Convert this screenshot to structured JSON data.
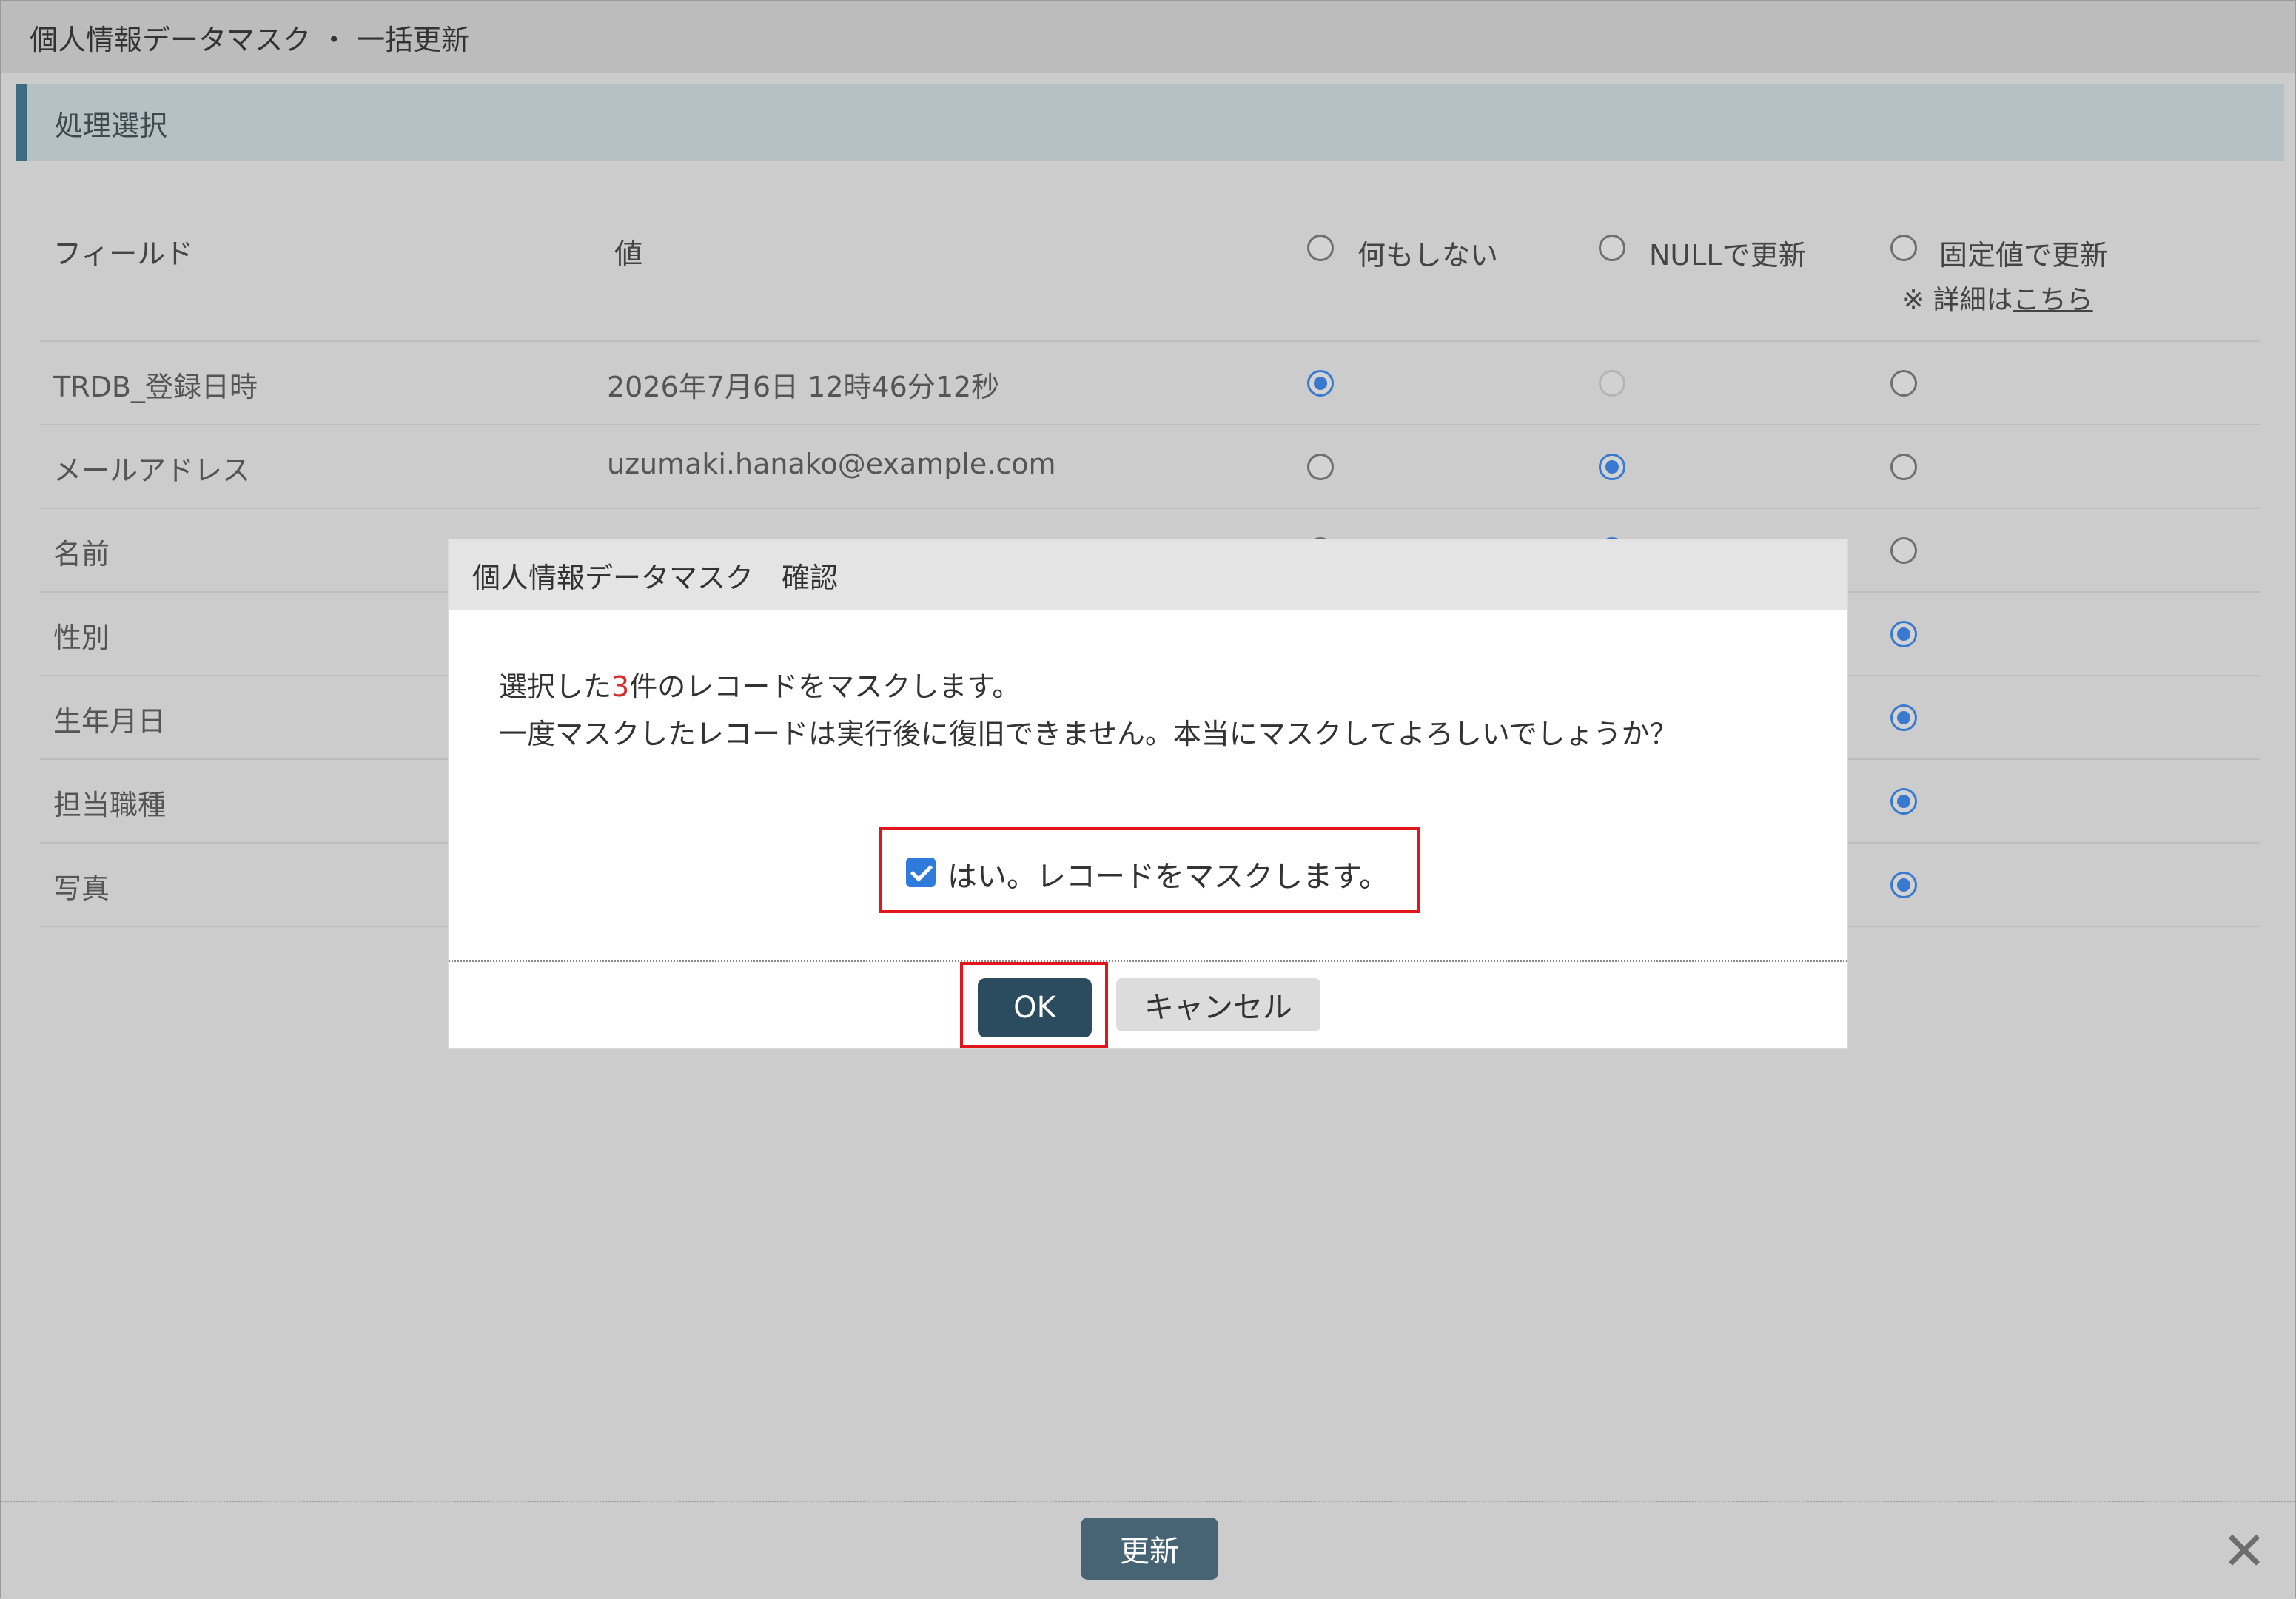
{
  "window": {
    "title": "個人情報データマスク ・ 一括更新"
  },
  "section": {
    "title": "処理選択"
  },
  "table": {
    "headers": {
      "field": "フィールド",
      "value": "値",
      "option_none": "何もしない",
      "option_null": "NULLで更新",
      "option_fixed": "固定値で更新",
      "note_prefix": "※ 詳細は",
      "note_link": "こちら"
    },
    "rows": [
      {
        "field": "TRDB_登録日時",
        "value": "2026年7月6日 12時46分12秒",
        "selected": "none",
        "null_disabled": true
      },
      {
        "field": "メールアドレス",
        "value": "uzumaki.hanako@example.com",
        "selected": "null",
        "null_disabled": false
      },
      {
        "field": "名前",
        "value": "",
        "selected": "null",
        "null_disabled": false
      },
      {
        "field": "性別",
        "value": "",
        "selected": "fixed",
        "null_disabled": false
      },
      {
        "field": "生年月日",
        "value": "",
        "selected": "fixed",
        "null_disabled": false
      },
      {
        "field": "担当職種",
        "value": "",
        "selected": "fixed",
        "null_disabled": false
      },
      {
        "field": "写真",
        "value": "",
        "selected": "fixed",
        "null_disabled": false
      }
    ]
  },
  "footer": {
    "update_label": "更新"
  },
  "modal": {
    "title": "個人情報データマスク　確認",
    "message_line1_prefix": "選択した",
    "message_count": "3",
    "message_line1_suffix": "件のレコードをマスクします。",
    "message_line2": "一度マスクしたレコードは実行後に復旧できません。本当にマスクしてよろしいでしょうか？",
    "confirm_checkbox_label": "はい。レコードをマスクします。",
    "confirm_checked": true,
    "ok_label": "OK",
    "cancel_label": "キャンセル"
  },
  "colors": {
    "accent": "#3a79d0",
    "section_bar": "#3f6b80",
    "highlight": "#e0161c",
    "ok_button": "#2a4c5e"
  }
}
